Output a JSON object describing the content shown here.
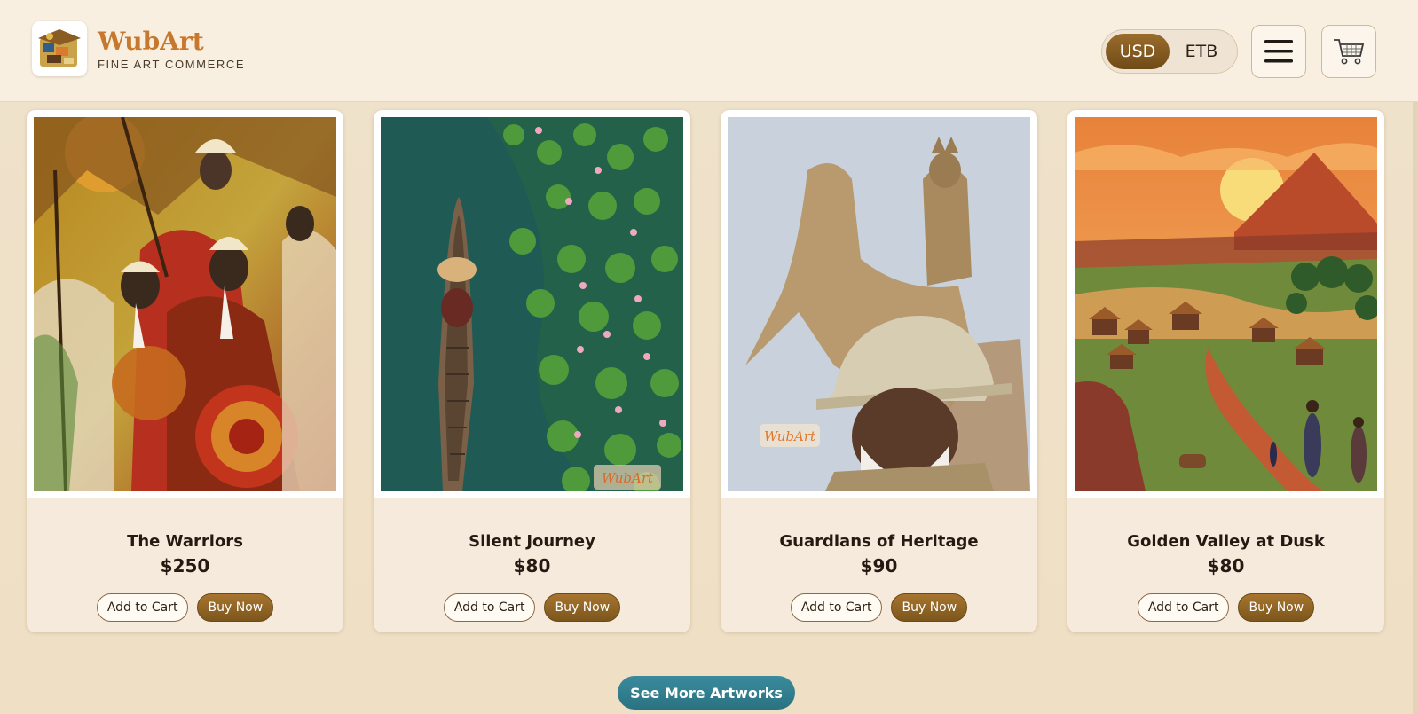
{
  "header": {
    "brand_name": "WubArt",
    "brand_tagline": "FINE ART COMMERCE",
    "logo_icon": "art-chest-logo",
    "currency": {
      "options": [
        "USD",
        "ETB"
      ],
      "selected": "USD"
    },
    "menu_icon": "hamburger-menu-icon",
    "cart_icon": "shopping-cart-icon"
  },
  "colors": {
    "brand": "#c8782c",
    "buy_button": "#8a6226",
    "see_more_button": "#2f7f90",
    "background": "#efe2cb"
  },
  "products": [
    {
      "title": "The Warriors",
      "price": "$250",
      "add_label": "Add to Cart",
      "buy_label": "Buy Now"
    },
    {
      "title": "Silent Journey",
      "price": "$80",
      "add_label": "Add to Cart",
      "buy_label": "Buy Now",
      "watermark": "WubArt"
    },
    {
      "title": "Guardians of Heritage",
      "price": "$90",
      "add_label": "Add to Cart",
      "buy_label": "Buy Now",
      "watermark": "WubArt"
    },
    {
      "title": "Golden Valley at Dusk",
      "price": "$80",
      "add_label": "Add to Cart",
      "buy_label": "Buy Now"
    }
  ],
  "see_more_label": "See More Artworks"
}
